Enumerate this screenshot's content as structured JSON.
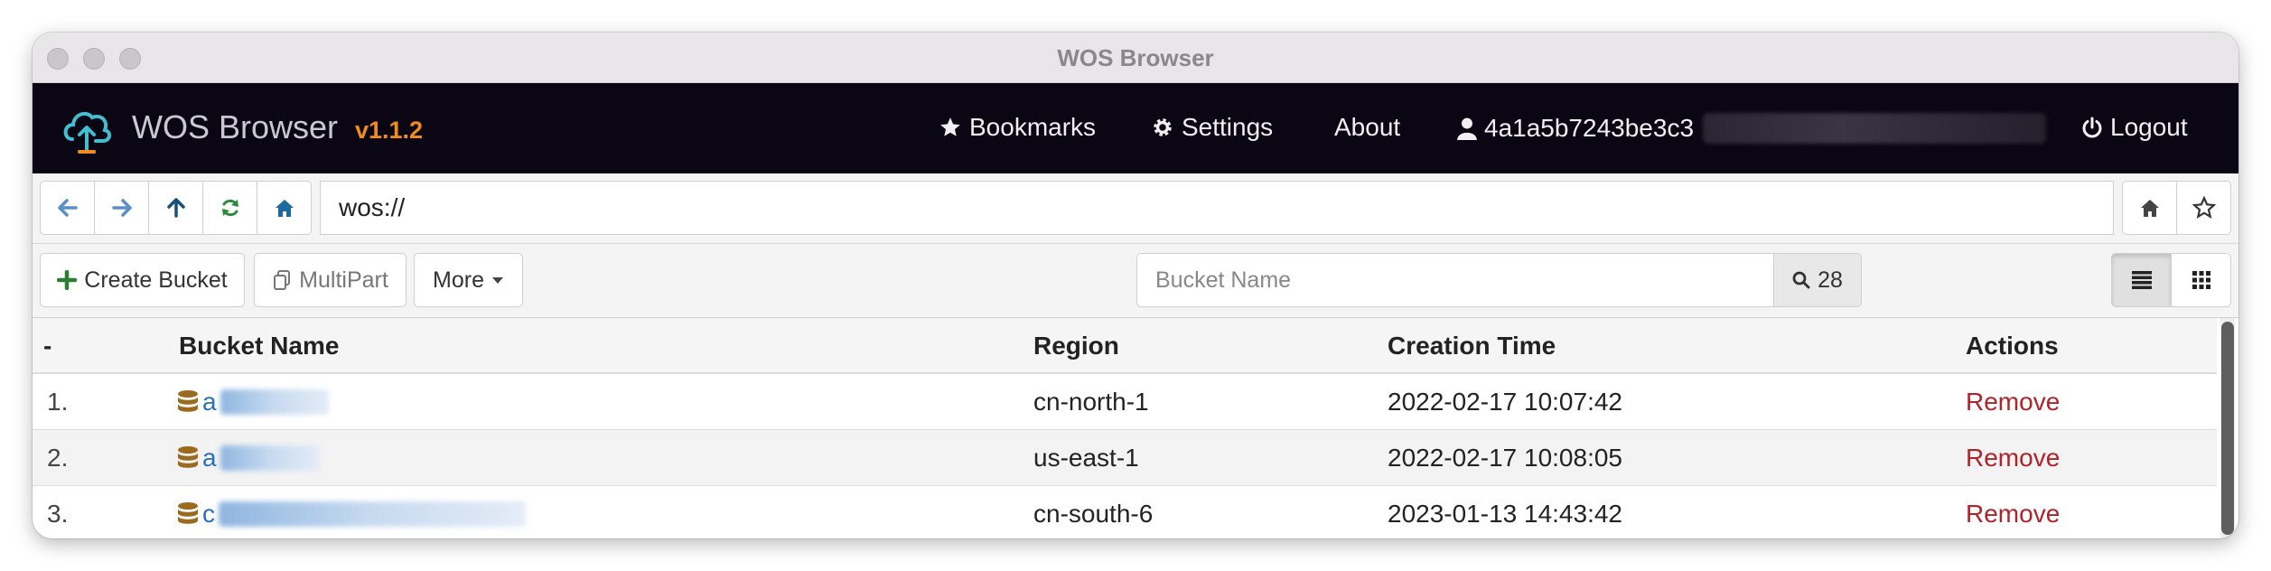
{
  "window": {
    "title": "WOS Browser"
  },
  "navbar": {
    "brand": "WOS Browser",
    "version": "v1.1.2",
    "bookmarks": "Bookmarks",
    "settings": "Settings",
    "about": "About",
    "user": "4a1a5b7243be3c3",
    "logout": "Logout",
    "accent_color": "#f08c1e"
  },
  "addressbar": {
    "address": "wos://"
  },
  "toolbar": {
    "create_bucket": "Create Bucket",
    "multipart": "MultiPart",
    "more": "More",
    "search_placeholder": "Bucket Name",
    "count": "28"
  },
  "table": {
    "headers": {
      "index": "-",
      "name": "Bucket Name",
      "region": "Region",
      "creation_time": "Creation Time",
      "actions": "Actions"
    },
    "rows": [
      {
        "index": "1.",
        "name": "a",
        "region": "cn-north-1",
        "creation_time": "2022-02-17 10:07:42",
        "action": "Remove"
      },
      {
        "index": "2.",
        "name": "a",
        "region": "us-east-1",
        "creation_time": "2022-02-17 10:08:05",
        "action": "Remove"
      },
      {
        "index": "3.",
        "name": "c",
        "region": "cn-south-6",
        "creation_time": "2023-01-13 14:43:42",
        "action": "Remove"
      }
    ]
  }
}
